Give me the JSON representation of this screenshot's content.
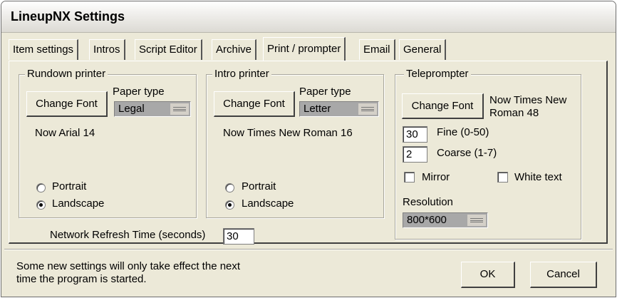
{
  "window": {
    "title": "LineupNX Settings"
  },
  "tabs": [
    {
      "label": "Item settings"
    },
    {
      "label": "Intros"
    },
    {
      "label": "Script Editor"
    },
    {
      "label": "Archive"
    },
    {
      "label": "Print / prompter",
      "active": true
    },
    {
      "label": "Email"
    },
    {
      "label": "General"
    }
  ],
  "rundown_printer": {
    "title": "Rundown printer",
    "change_font_label": "Change Font",
    "paper_type_label": "Paper type",
    "paper_type_value": "Legal",
    "font_now": "Now Arial 14",
    "portrait_label": "Portrait",
    "landscape_label": "Landscape",
    "orientation_selected": "Landscape"
  },
  "intro_printer": {
    "title": "Intro printer",
    "change_font_label": "Change Font",
    "paper_type_label": "Paper type",
    "paper_type_value": "Letter",
    "font_now": "Now Times New Roman 16",
    "portrait_label": "Portrait",
    "landscape_label": "Landscape",
    "orientation_selected": "Landscape"
  },
  "teleprompter": {
    "title": "Teleprompter",
    "change_font_label": "Change Font",
    "font_now_line1": "Now Times New",
    "font_now_line2": "Roman 48",
    "fine_value": "30",
    "fine_label": "Fine (0-50)",
    "coarse_value": "2",
    "coarse_label": "Coarse (1-7)",
    "mirror_label": "Mirror",
    "mirror_checked": false,
    "white_text_label": "White text",
    "white_text_checked": false,
    "resolution_label": "Resolution",
    "resolution_value": "800*600"
  },
  "network": {
    "label": "Network Refresh Time (seconds)",
    "value": "30"
  },
  "footer": {
    "note_line1": "Some new settings will only take effect the next",
    "note_line2": "time the program is started.",
    "ok_label": "OK",
    "cancel_label": "Cancel"
  }
}
